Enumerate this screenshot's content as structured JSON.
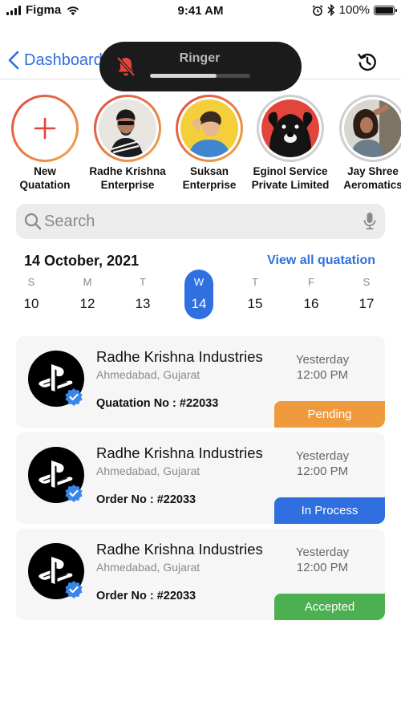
{
  "status_bar": {
    "carrier": "Figma",
    "time": "9:41 AM",
    "battery": "100%"
  },
  "nav": {
    "back_label": "Dashboard"
  },
  "ringer": {
    "label": "Ringer",
    "level": 0.66
  },
  "stories": [
    {
      "line1": "New",
      "line2": "Quatation"
    },
    {
      "line1": "Radhe Krishna",
      "line2": "Enterprise"
    },
    {
      "line1": "Suksan",
      "line2": "Enterprise"
    },
    {
      "line1": "Eginol Service",
      "line2": "Private Limited"
    },
    {
      "line1": "Jay Shree",
      "line2": "Aeromatics"
    }
  ],
  "search": {
    "placeholder": "Search"
  },
  "calendar": {
    "date_title": "14 October, 2021",
    "view_all": "View all quatation",
    "days": [
      {
        "name": "S",
        "num": "10"
      },
      {
        "name": "M",
        "num": "12"
      },
      {
        "name": "T",
        "num": "13"
      },
      {
        "name": "W",
        "num": "14"
      },
      {
        "name": "T",
        "num": "15"
      },
      {
        "name": "F",
        "num": "16"
      },
      {
        "name": "S",
        "num": "17"
      }
    ]
  },
  "cards": [
    {
      "title": "Radhe Krishna Industries",
      "location": "Ahmedabad, Gujarat",
      "number": "Quatation No : #22033",
      "time_line1": "Yesterday",
      "time_line2": "12:00 PM",
      "status": "Pending",
      "status_color": "#f09a3e"
    },
    {
      "title": "Radhe Krishna Industries",
      "location": "Ahmedabad, Gujarat",
      "number": "Order No : #22033",
      "time_line1": "Yesterday",
      "time_line2": "12:00 PM",
      "status": "In Process",
      "status_color": "#2f6fe0"
    },
    {
      "title": "Radhe Krishna Industries",
      "location": "Ahmedabad, Gujarat",
      "number": "Order No : #22033",
      "time_line1": "Yesterday",
      "time_line2": "12:00 PM",
      "status": "Accepted",
      "status_color": "#4caf50"
    }
  ],
  "colors": {
    "accent": "#2f6fe0",
    "pending": "#f09a3e",
    "in_process": "#2f6fe0",
    "accepted": "#4caf50"
  }
}
